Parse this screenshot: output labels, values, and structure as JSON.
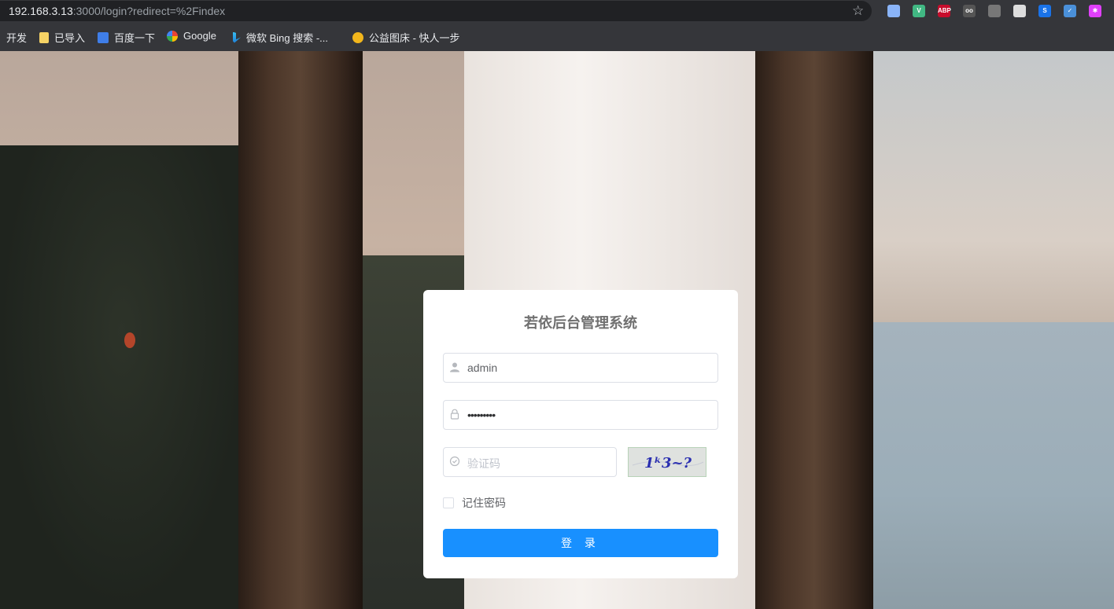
{
  "browser": {
    "url_host": "192.168.3.13",
    "url_rest": ":3000/login?redirect=%2Findex",
    "bookmarks": [
      {
        "label": "开发",
        "icon": "none"
      },
      {
        "label": "已导入",
        "icon": "folder-icon"
      },
      {
        "label": "百度一下",
        "icon": "baidu-icon"
      },
      {
        "label": "Google",
        "icon": "google-icon"
      },
      {
        "label": "微软 Bing 搜索 -...",
        "icon": "bing-icon"
      },
      {
        "label": "公益图床 - 快人一步",
        "icon": "image-host-icon"
      }
    ],
    "extensions": [
      {
        "name": "chart-ext-icon",
        "text": "",
        "color": "#8ab4f8"
      },
      {
        "name": "vue-devtools-icon",
        "text": "V",
        "color": "#41b883"
      },
      {
        "name": "adblock-icon",
        "text": "ABP",
        "color": "#c70d2c"
      },
      {
        "name": "game-ext-icon",
        "text": "oo",
        "color": "#555555"
      },
      {
        "name": "screenshot-ext-icon",
        "text": "",
        "color": "#777777"
      },
      {
        "name": "circle-ext-icon",
        "text": "",
        "color": "#dddddd"
      },
      {
        "name": "s-ext-icon",
        "text": "S",
        "color": "#1a73e8"
      },
      {
        "name": "check-ext-icon",
        "text": "✓",
        "color": "#4a90d9"
      },
      {
        "name": "star-ext-icon",
        "text": "✱",
        "color": "#e040fb"
      }
    ]
  },
  "login": {
    "title": "若依后台管理系统",
    "username_value": "admin",
    "password_mask": "•••••••••",
    "code_placeholder": "验证码",
    "captcha_text": "1ᵏ3~?",
    "remember_label": "记住密码",
    "remember_checked": false,
    "login_button": "登 录"
  }
}
